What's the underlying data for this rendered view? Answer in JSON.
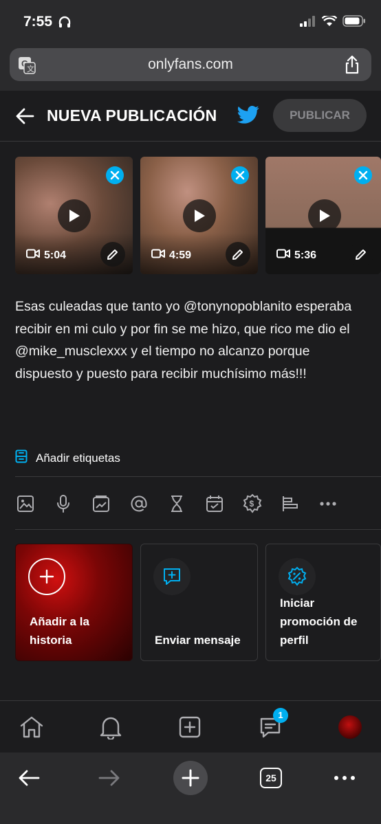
{
  "status": {
    "time": "7:55"
  },
  "browser": {
    "url": "onlyfans.com",
    "tabs_count": "25"
  },
  "header": {
    "title": "NUEVA PUBLICACIÓN",
    "publish_label": "PUBLICAR"
  },
  "media": [
    {
      "duration": "5:04"
    },
    {
      "duration": "4:59"
    },
    {
      "duration": "5:36"
    }
  ],
  "post": {
    "caption": "Esas culeadas que tanto yo @tonynopoblanito esperaba recibir en mi culo y por fin se me hizo, que rico me dio el @mike_musclexxx y el tiempo no alcanzo porque dispuesto y puesto para recibir muchísimo más!!!"
  },
  "tags": {
    "label": "Añadir etiquetas"
  },
  "cards": [
    {
      "label": "Añadir a la historia"
    },
    {
      "label": "Enviar mensaje"
    },
    {
      "label": "Iniciar promoción de perfil"
    }
  ],
  "nav": {
    "messages_badge": "1"
  },
  "colors": {
    "accent": "#00aff0",
    "background": "#1c1c1e",
    "twitter": "#1da1f2"
  }
}
